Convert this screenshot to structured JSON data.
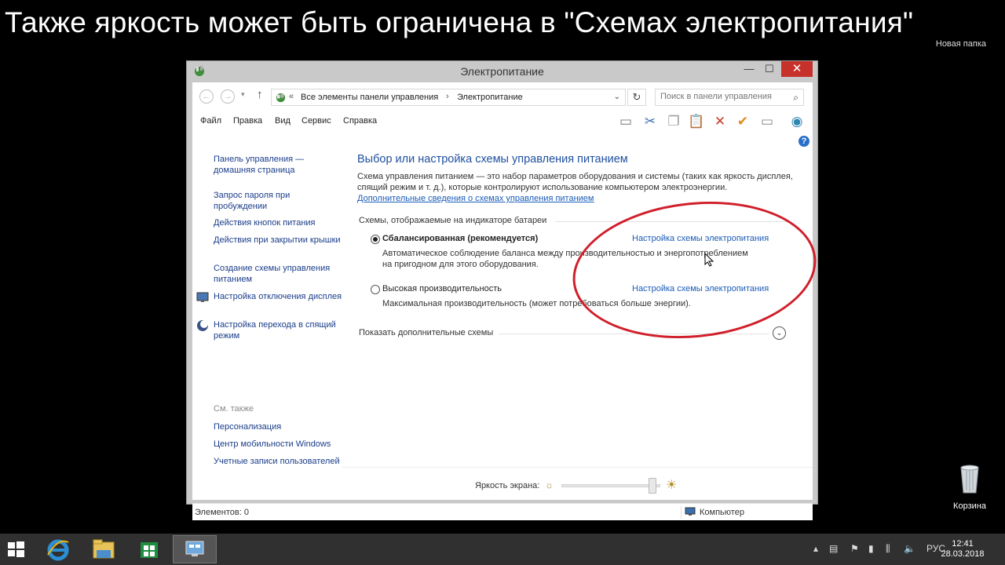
{
  "caption": "Также яркость может быть ограничена в \"Схемах электропитания\"",
  "desktop": {
    "folder_label": "Новая папка",
    "recycle_bin_label": "Корзина"
  },
  "window": {
    "title": "Электропитание",
    "controls": {
      "minimize": "—",
      "maximize": "☐",
      "close": "✕"
    }
  },
  "address_bar": {
    "separator": "«",
    "crumb_separator": "›",
    "parts": [
      "Все элементы панели управления",
      "Электропитание"
    ],
    "dropdown": "⌄",
    "refresh": "↻"
  },
  "search": {
    "placeholder": "Поиск в панели управления",
    "icon": "search-icon"
  },
  "menu": [
    "Файл",
    "Правка",
    "Вид",
    "Сервис",
    "Справка"
  ],
  "left_nav": {
    "links": [
      "Панель управления — домашняя страница",
      "Запрос пароля при пробуждении",
      "Действия кнопок питания",
      "Действия при закрытии крышки",
      "Создание схемы управления питанием",
      "Настройка отключения дисплея",
      "Настройка перехода в спящий режим"
    ],
    "see_also": "См. также",
    "see_also_links": [
      "Персонализация",
      "Центр мобильности Windows",
      "Учетные записи пользователей"
    ]
  },
  "main": {
    "heading": "Выбор или настройка схемы управления питанием",
    "description": "Схема управления питанием — это набор параметров оборудования и системы (таких как яркость дисплея, спящий режим и т. д.), которые контролируют использование компьютером электроэнергии.",
    "more_link": "Дополнительные сведения о схемах управления питанием",
    "group_label": "Схемы, отображаемые на индикаторе батареи",
    "plans": [
      {
        "name": "Сбалансированная (рекомендуется)",
        "selected": true,
        "link": "Настройка схемы электропитания",
        "desc": "Автоматическое соблюдение баланса между производительностью и энергопотреблением на пригодном для этого оборудования."
      },
      {
        "name": "Высокая производительность",
        "selected": false,
        "link": "Настройка схемы электропитания",
        "desc": "Максимальная производительность (может потребоваться больше энергии)."
      }
    ],
    "show_more": "Показать дополнительные схемы",
    "brightness_label": "Яркость экрана:",
    "brightness_level": 0.95
  },
  "status_bar": {
    "left": "Элементов: 0",
    "right": "Компьютер"
  },
  "taskbar": {
    "apps": [
      "internet-explorer-icon",
      "file-explorer-icon",
      "store-icon",
      "control-panel-icon"
    ],
    "language": "РУС",
    "time": "12:41",
    "date": "28.03.2018"
  },
  "colors": {
    "annotation": "#d01f2a",
    "link": "#1a5cb8",
    "heading": "#1e4f9f",
    "close": "#c7312b"
  }
}
